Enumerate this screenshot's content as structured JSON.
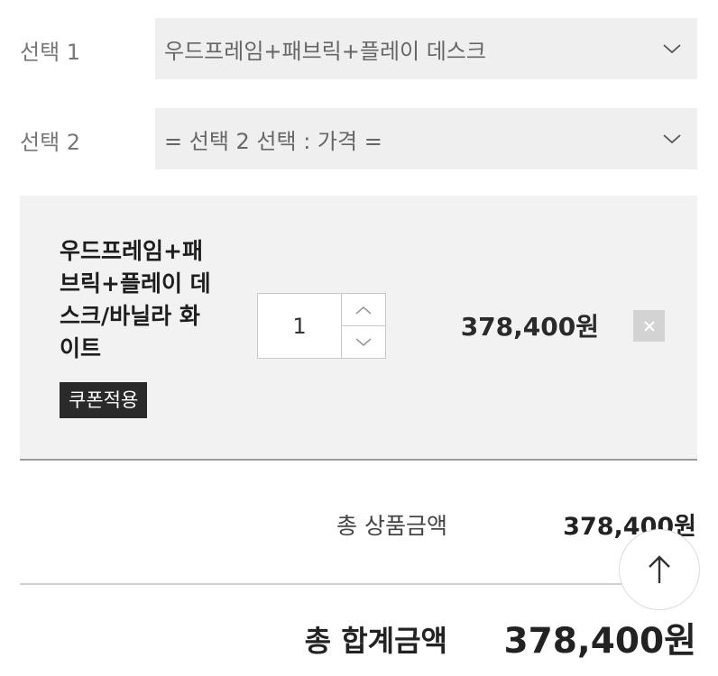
{
  "options": [
    {
      "label": "선택 1",
      "value": "우드프레임+패브릭+플레이 데스크"
    },
    {
      "label": "선택 2",
      "value": "= 선택 2 선택 : 가격 ="
    }
  ],
  "selected_item": {
    "name_lines": [
      "우드프레임+패",
      "브릭+플레이 데",
      "스크/바닐라 화",
      "이트"
    ],
    "coupon_label": "쿠폰적용",
    "quantity": "1",
    "price": "378,400원"
  },
  "summary": {
    "product_total_label": "총 상품금액",
    "product_total_value": "378,400원",
    "grand_total_label": "총 합계금액",
    "grand_total_value": "378,400원"
  },
  "icons": {
    "select_chevron": "chevron-down-icon",
    "qty_up": "chevron-up-icon",
    "qty_down": "chevron-down-icon",
    "remove": "close-icon",
    "scroll_top": "arrow-up-icon"
  }
}
